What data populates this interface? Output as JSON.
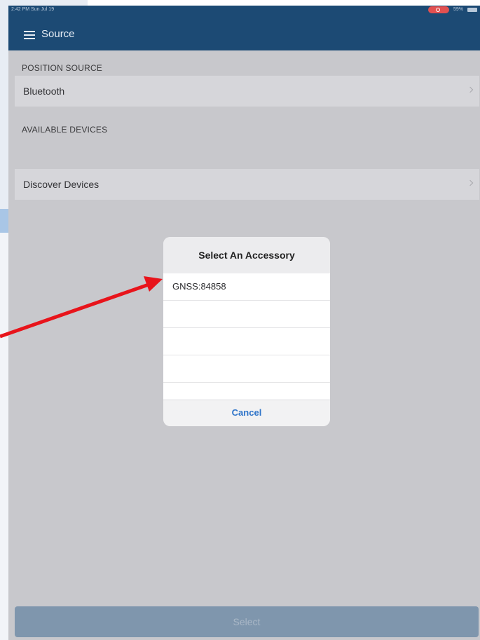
{
  "status_bar": {
    "time": "2:42 PM  Sun Jul 19",
    "battery_text": "59%"
  },
  "nav": {
    "title": "Source"
  },
  "sections": {
    "position_source": {
      "header": "POSITION SOURCE",
      "value": "Bluetooth"
    },
    "available_devices": {
      "header": "AVAILABLE DEVICES",
      "discover_label": "Discover Devices"
    }
  },
  "dialog": {
    "title": "Select An Accessory",
    "items": [
      "GNSS:84858",
      "",
      "",
      ""
    ],
    "cancel_label": "Cancel"
  },
  "footer": {
    "select_label": "Select"
  },
  "colors": {
    "nav_bar": "#1c4a74",
    "screen_bg": "#c8c8cc",
    "cancel_link": "#2e74c9",
    "select_button": "#7f96ad",
    "annotation_arrow": "#e8141b"
  },
  "icons": [
    "hamburger-icon",
    "chevron-right-icon",
    "recording-indicator-icon",
    "battery-icon"
  ]
}
